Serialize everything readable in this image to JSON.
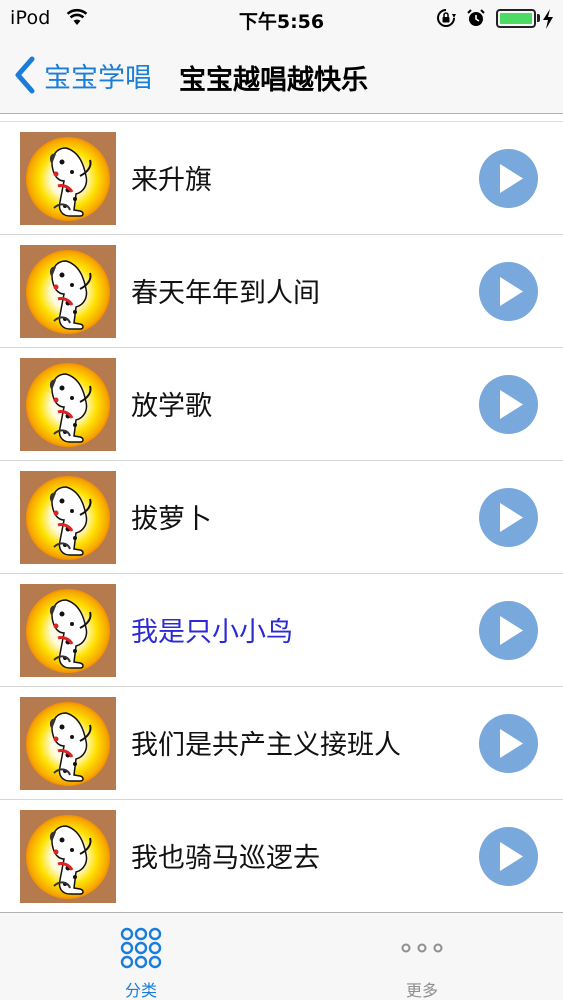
{
  "status_bar": {
    "carrier": "iPod",
    "time": "下午5:56",
    "battery_level": 1.0,
    "icons": [
      "wifi-icon",
      "orientation-lock-icon",
      "alarm-icon",
      "battery-icon",
      "charging-bolt-icon"
    ]
  },
  "nav": {
    "back_label": "宝宝学唱",
    "title": "宝宝越唱越快乐"
  },
  "songs": [
    {
      "title": "来升旗"
    },
    {
      "title": "春天年年到人间"
    },
    {
      "title": "放学歌"
    },
    {
      "title": "拔萝卜"
    },
    {
      "title": "我是只小小鸟",
      "active": true
    },
    {
      "title": "我们是共产主义接班人"
    },
    {
      "title": "我也骑马巡逻去"
    }
  ],
  "tabs": {
    "categories_label": "分类",
    "more_label": "更多"
  },
  "colors": {
    "accent": "#1a7dd8",
    "active_song": "#2b2bd6",
    "play_button": "#78a8dc",
    "battery": "#4cd964"
  }
}
